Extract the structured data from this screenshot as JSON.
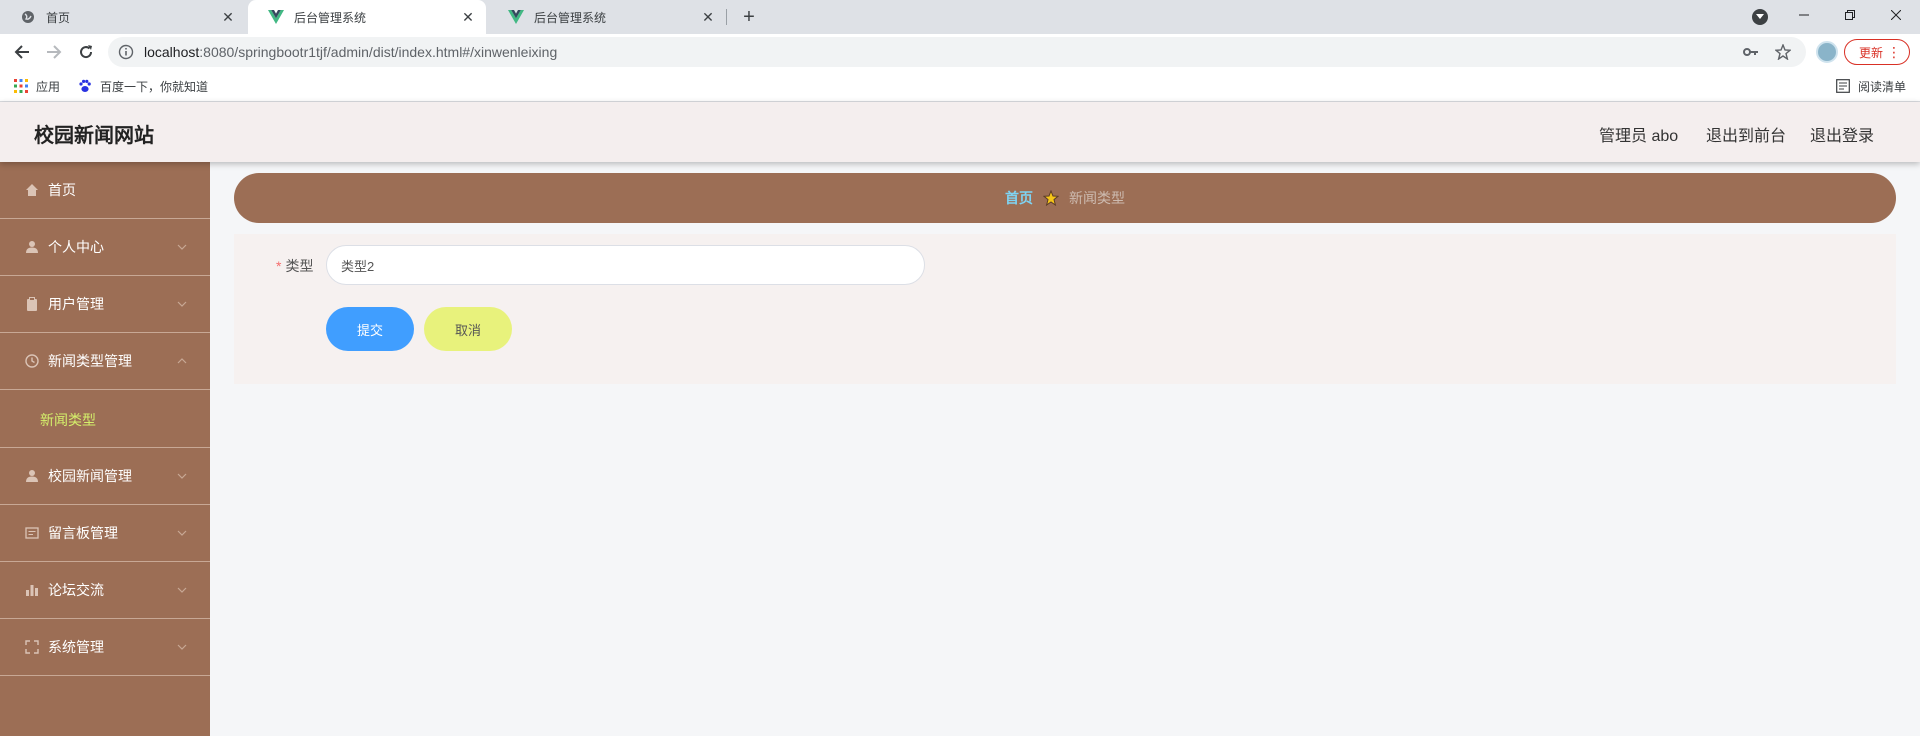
{
  "browser": {
    "tabs": [
      {
        "title": "首页",
        "icon": "globe-icon",
        "active": false
      },
      {
        "title": "后台管理系统",
        "icon": "vue-icon",
        "active": true
      },
      {
        "title": "后台管理系统",
        "icon": "vue-icon",
        "active": false
      }
    ],
    "url_host": "localhost",
    "url_rest": ":8080/springbootr1tjf/admin/dist/index.html#/xinwenleixing",
    "update_label": "更新",
    "bookmarks": [
      {
        "label": "应用",
        "icon": "apps-grid-icon"
      },
      {
        "label": "百度一下，你就知道",
        "icon": "baidu-paw-icon"
      }
    ],
    "reading_list_label": "阅读清单"
  },
  "header": {
    "site_title": "校园新闻网站",
    "admin_label": "管理员 abo",
    "to_front_label": "退出到前台",
    "logout_label": "退出登录"
  },
  "sidebar": {
    "items": [
      {
        "label": "首页",
        "icon": "home-icon",
        "has_chevron": false
      },
      {
        "label": "个人中心",
        "icon": "user-icon",
        "has_chevron": true
      },
      {
        "label": "用户管理",
        "icon": "clipboard-icon",
        "has_chevron": true
      },
      {
        "label": "新闻类型管理",
        "icon": "clock-icon",
        "has_chevron": true,
        "expanded": true
      },
      {
        "label": "校园新闻管理",
        "icon": "user-icon",
        "has_chevron": true
      },
      {
        "label": "留言板管理",
        "icon": "message-board-icon",
        "has_chevron": true
      },
      {
        "label": "论坛交流",
        "icon": "bar-chart-icon",
        "has_chevron": true
      },
      {
        "label": "系统管理",
        "icon": "fullscreen-icon",
        "has_chevron": true
      }
    ],
    "submenu_active": "新闻类型"
  },
  "breadcrumb": {
    "home": "首页",
    "current": "新闻类型"
  },
  "form": {
    "type_label": "类型",
    "required_mark": "*",
    "type_value": "类型2",
    "submit_label": "提交",
    "cancel_label": "取消"
  },
  "colors": {
    "sidebar_bg": "#9c6e55",
    "header_bg": "#f4eeee",
    "submenu_active": "#d4f06b",
    "breadcrumb_home": "#7fd3f2",
    "submit_bg": "#409eff",
    "cancel_bg": "#e8f27c"
  }
}
